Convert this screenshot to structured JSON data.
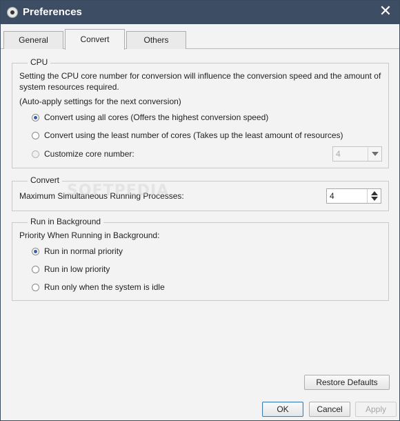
{
  "window": {
    "title": "Preferences",
    "app_icon": "speaker-icon",
    "close_icon": "close-icon"
  },
  "tabs": [
    {
      "label": "General",
      "active": false
    },
    {
      "label": "Convert",
      "active": true
    },
    {
      "label": "Others",
      "active": false
    }
  ],
  "cpu": {
    "group_label": "CPU",
    "description_line1": "Setting the CPU core number for conversion will influence the conversion speed and the amount of",
    "description_line2": "system resources required.",
    "auto_apply": "(Auto-apply settings for the next conversion)",
    "options": [
      {
        "label": "Convert using all cores (Offers the highest conversion speed)",
        "checked": true
      },
      {
        "label": "Convert using the least number of cores (Takes up the least amount of resources)",
        "checked": false
      },
      {
        "label": "Customize core number:",
        "checked": false
      }
    ],
    "core_select": {
      "value": "4",
      "disabled": true
    }
  },
  "convert": {
    "group_label": "Convert",
    "max_processes_label": "Maximum Simultaneous Running Processes:",
    "max_processes_value": "4"
  },
  "background": {
    "group_label": "Run in Background",
    "priority_label": "Priority When Running in Background:",
    "options": [
      {
        "label": "Run in normal priority",
        "checked": true
      },
      {
        "label": "Run in low priority",
        "checked": false
      },
      {
        "label": "Run only when the system is idle",
        "checked": false
      }
    ]
  },
  "buttons": {
    "restore_defaults": "Restore Defaults",
    "ok": "OK",
    "cancel": "Cancel",
    "apply": "Apply"
  },
  "watermark": "SOFTPEDIA",
  "colors": {
    "titlebar": "#3d4d63",
    "radio_dot": "#3a5ca8",
    "default_button_border": "#3c7fb1"
  }
}
